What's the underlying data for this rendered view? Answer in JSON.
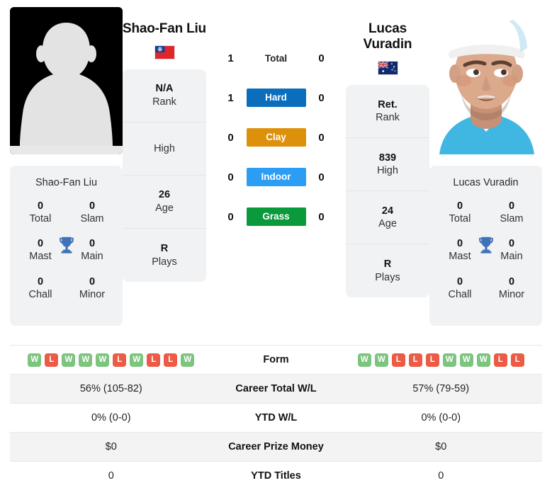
{
  "players": {
    "left": {
      "name": "Shao-Fan Liu",
      "name_line1": "Shao-Fan",
      "name_line2": "Liu",
      "flag": "taiwan-flag",
      "photo": "placeholder-avatar",
      "info": [
        {
          "value": "N/A",
          "label": "Rank"
        },
        {
          "value": "",
          "label": "High"
        },
        {
          "value": "26",
          "label": "Age"
        },
        {
          "value": "R",
          "label": "Plays"
        }
      ],
      "titles": {
        "card_name": "Shao-Fan Liu",
        "rows": [
          [
            {
              "value": "0",
              "label": "Total"
            },
            {
              "value": "0",
              "label": "Slam"
            }
          ],
          [
            {
              "value": "0",
              "label": "Mast"
            },
            {
              "value": "0",
              "label": "Main"
            }
          ],
          [
            {
              "value": "0",
              "label": "Chall"
            },
            {
              "value": "0",
              "label": "Minor"
            }
          ]
        ]
      },
      "form": [
        "W",
        "L",
        "W",
        "W",
        "W",
        "L",
        "W",
        "L",
        "L",
        "W"
      ],
      "career_total_wl": "56% (105-82)",
      "ytd_wl": "0% (0-0)",
      "career_prize_money": "$0",
      "ytd_titles": "0"
    },
    "right": {
      "name": "Lucas Vuradin",
      "name_line1": "Lucas",
      "name_line2": "Vuradin",
      "flag": "australia-flag",
      "photo": "player-photo",
      "info": [
        {
          "value": "Ret.",
          "label": "Rank"
        },
        {
          "value": "839",
          "label": "High"
        },
        {
          "value": "24",
          "label": "Age"
        },
        {
          "value": "R",
          "label": "Plays"
        }
      ],
      "titles": {
        "card_name": "Lucas Vuradin",
        "rows": [
          [
            {
              "value": "0",
              "label": "Total"
            },
            {
              "value": "0",
              "label": "Slam"
            }
          ],
          [
            {
              "value": "0",
              "label": "Mast"
            },
            {
              "value": "0",
              "label": "Main"
            }
          ],
          [
            {
              "value": "0",
              "label": "Chall"
            },
            {
              "value": "0",
              "label": "Minor"
            }
          ]
        ]
      },
      "form": [
        "W",
        "W",
        "L",
        "L",
        "L",
        "W",
        "W",
        "W",
        "L",
        "L"
      ],
      "career_total_wl": "57% (79-59)",
      "ytd_wl": "0% (0-0)",
      "career_prize_money": "$0",
      "ytd_titles": "0"
    }
  },
  "h2h": [
    {
      "label": "Total",
      "left": "1",
      "right": "0",
      "type": "plain",
      "color": ""
    },
    {
      "label": "Hard",
      "left": "1",
      "right": "0",
      "type": "badge",
      "color": "#0a6ebd"
    },
    {
      "label": "Clay",
      "left": "0",
      "right": "0",
      "type": "badge",
      "color": "#dd9009"
    },
    {
      "label": "Indoor",
      "left": "0",
      "right": "0",
      "type": "badge",
      "color": "#2b9df4"
    },
    {
      "label": "Grass",
      "left": "0",
      "right": "0",
      "type": "badge",
      "color": "#0a9a3c"
    }
  ],
  "comparison": {
    "labels": {
      "form": "Form",
      "career_total_wl": "Career Total W/L",
      "ytd_wl": "YTD W/L",
      "career_prize_money": "Career Prize Money",
      "ytd_titles": "YTD Titles"
    }
  },
  "colors": {
    "card_bg": "#f1f2f3",
    "row_shade": "#f3f3f3",
    "win": "#7dc47f",
    "loss": "#eb5b45",
    "trophy": "#3f72b8"
  }
}
